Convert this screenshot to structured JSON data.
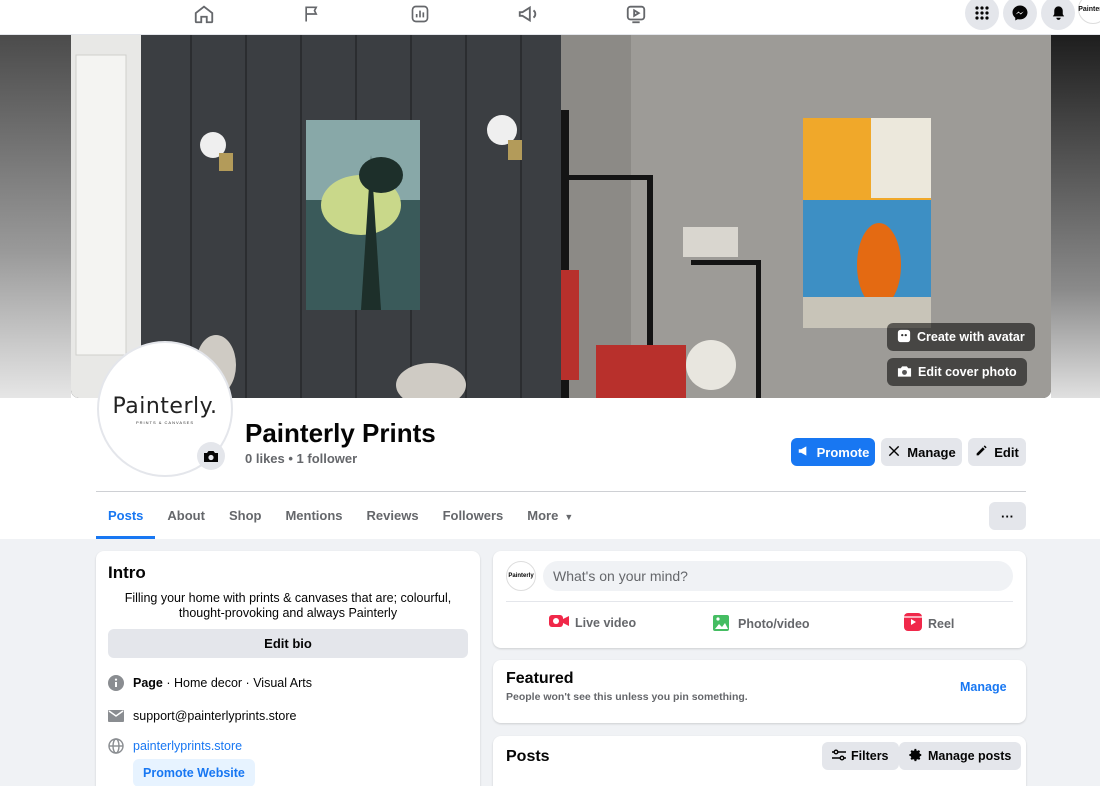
{
  "nav": {
    "icons": [
      "home-icon",
      "flag-icon",
      "insights-icon",
      "megaphone-icon",
      "video-icon"
    ],
    "right_icons": [
      "menu-grid-icon",
      "messenger-icon",
      "bell-icon"
    ],
    "mini_avatar_label": "Painterly"
  },
  "cover": {
    "create_avatar_label": "Create with avatar",
    "edit_cover_label": "Edit cover photo"
  },
  "profile": {
    "logo_text": "Painterly.",
    "logo_sub": "PRINTS & CANVASES",
    "name": "Painterly Prints",
    "stats": "0 likes • 1 follower"
  },
  "actions": {
    "promote": "Promote",
    "manage": "Manage",
    "edit": "Edit",
    "more_dots": "···"
  },
  "tabs": [
    {
      "label": "Posts",
      "active": true
    },
    {
      "label": "About"
    },
    {
      "label": "Shop"
    },
    {
      "label": "Mentions"
    },
    {
      "label": "Reviews"
    },
    {
      "label": "Followers"
    },
    {
      "label": "More"
    }
  ],
  "intro": {
    "title": "Intro",
    "description": "Filling your home with prints & canvases that are; colourful, thought-provoking and always Painterly",
    "edit_bio": "Edit bio",
    "page_label": "Page",
    "page_category": " · Home decor · Visual Arts",
    "email": "support@painterlyprints.store",
    "website": "painterlyprints.store",
    "promote_website": "Promote Website"
  },
  "composer": {
    "placeholder": "What's on your mind?",
    "live": "Live video",
    "photo": "Photo/video",
    "reel": "Reel"
  },
  "featured": {
    "title": "Featured",
    "subtitle": "People won't see this unless you pin something.",
    "manage": "Manage"
  },
  "posts": {
    "title": "Posts",
    "filters": "Filters",
    "manage_posts": "Manage posts"
  },
  "colors": {
    "accent": "#1877f2",
    "background": "#f0f2f5"
  }
}
